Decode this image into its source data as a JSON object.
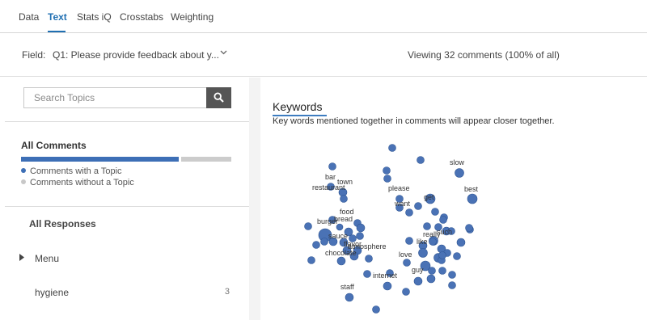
{
  "tabs": [
    {
      "label": "Data",
      "active": false
    },
    {
      "label": "Text",
      "active": true
    },
    {
      "label": "Stats iQ",
      "active": false
    },
    {
      "label": "Crosstabs",
      "active": false
    },
    {
      "label": "Weighting",
      "active": false
    }
  ],
  "field": {
    "label": "Field:",
    "value": "Q1: Please provide feedback about y...",
    "chevron_icon": "chevron-down-icon"
  },
  "viewing_text": "Viewing 32 comments (100% of all)",
  "sidebar": {
    "search": {
      "placeholder": "Search Topics",
      "value": "",
      "icon": "search-icon"
    },
    "all_comments_title": "All Comments",
    "topic_share": 0.75,
    "legend": [
      {
        "label": "Comments with a Topic",
        "color": "#3d6fb6"
      },
      {
        "label": "Comments without a Topic",
        "color": "#c8c8c8"
      }
    ],
    "all_responses_title": "All Responses",
    "items": [
      {
        "label": "Menu",
        "count": "",
        "expandable": true
      },
      {
        "label": "hygiene",
        "count": "3",
        "expandable": false
      }
    ]
  },
  "keywords": {
    "title": "Keywords",
    "description": "Key words mentioned together in comments will appear closer together.",
    "node_color": "#4a72b5",
    "labels": [
      "slow",
      "bar",
      "town",
      "restaurant",
      "please",
      "best",
      "get",
      "want",
      "food",
      "burger",
      "bread",
      "really",
      "such",
      "sauce",
      "like",
      "atmosphere",
      "flavor",
      "chocolate",
      "love",
      "guy",
      "internet",
      "staff"
    ]
  }
}
